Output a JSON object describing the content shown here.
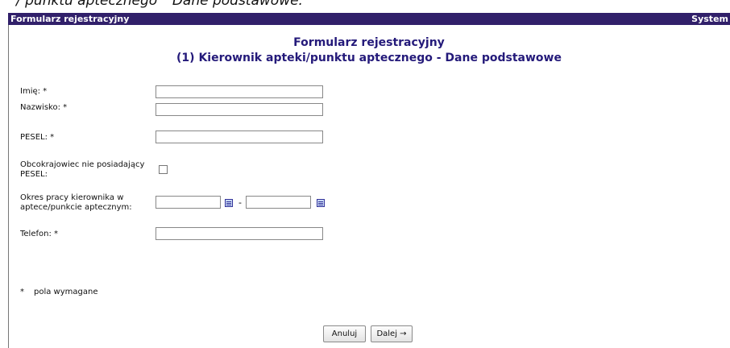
{
  "caption": "/ punktu aptecznego \" Dane podstawowe.",
  "titlebar": {
    "left": "Formularz rejestracyjny",
    "right": "System"
  },
  "heading": {
    "line1": "Formularz rejestracyjny",
    "line2": "(1) Kierownik apteki/punktu aptecznego - Dane podstawowe"
  },
  "fields": {
    "imie_label": "Imię: *",
    "nazwisko_label": "Nazwisko: *",
    "pesel_label": "PESEL: *",
    "foreigner_label_1": "Obcokrajowiec nie posiadający",
    "foreigner_label_2": "PESEL:",
    "okres_label_1": "Okres pracy kierownika w",
    "okres_label_2": "aptece/punkcie aptecznym:",
    "date_separator": "-",
    "telefon_label": "Telefon: *",
    "imie_value": "",
    "nazwisko_value": "",
    "pesel_value": "",
    "date_from_value": "",
    "date_to_value": "",
    "telefon_value": ""
  },
  "note": {
    "star": "*",
    "text": "pola wymagane"
  },
  "buttons": {
    "cancel": "Anuluj",
    "next": "Dalej →"
  },
  "colors": {
    "titlebar_bg": "#31206a",
    "heading": "#241a7a"
  },
  "icons": {
    "calendar": "calendar-icon"
  }
}
